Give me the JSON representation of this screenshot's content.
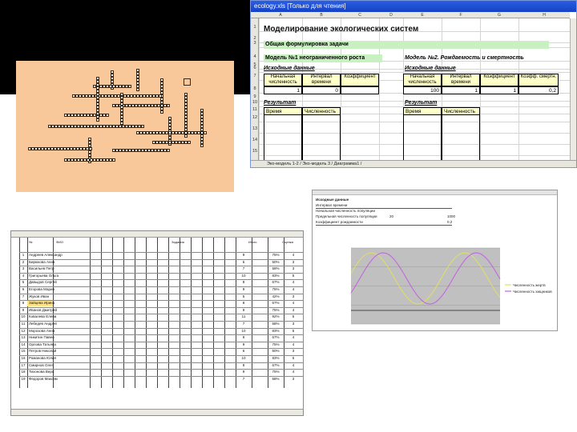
{
  "ecology": {
    "window_title": "ecology.xls [Только для чтения]",
    "columns": [
      "A",
      "B",
      "C",
      "D",
      "E",
      "F",
      "G",
      "H"
    ],
    "rows": [
      "1",
      "2",
      "3",
      "4",
      "5",
      "6",
      "7",
      "8",
      "9",
      "10",
      "11",
      "12",
      "13",
      "14",
      "15"
    ],
    "doc_title": "Моделирование экологических систем",
    "task_label": "Общая формулировка задачи",
    "model1_title": "Модель №1 неограниченного роста",
    "model2_title": "Модель №2. Рождаемость и смертность",
    "initial_data_left": "Исходные данные",
    "initial_data_right": "Исходные данные",
    "left_headers": [
      "Начальная численность",
      "Интервал времени",
      "Коэффициент"
    ],
    "right_headers": [
      "Начальная численность",
      "Интервал времени",
      "Коэффициент",
      "Коэфф. смертн."
    ],
    "left_values": [
      "1",
      "0",
      ""
    ],
    "right_values": [
      "100",
      "1",
      "1",
      "0,2"
    ],
    "result_left": "Результат",
    "result_right": "Результат",
    "result_headers_left": [
      "Время",
      "Численность"
    ],
    "result_headers_right": [
      "Время",
      "Численность"
    ],
    "sheet_tabs": "Эко-модель 1-2 / Эко-модель 3 / Диаграмма1 /"
  },
  "chart_window": {
    "lines": [
      "Исходные данные",
      "Интервал времени",
      "Начальная численность популяции",
      "Предельная численность популяции",
      "Коэффициент рождаемости"
    ],
    "values": [
      "20",
      "1000",
      "0,2"
    ],
    "legend": [
      "Численность жертв",
      "Численность хищников"
    ]
  },
  "grades": {
    "header_labels": [
      "№",
      "ФИО",
      "Задания",
      "Итого",
      "Оценка"
    ],
    "rows": [
      {
        "n": "1",
        "name": "Андреев Александр",
        "total": "9",
        "pct": "75%",
        "grade": "4"
      },
      {
        "n": "2",
        "name": "Бирюкова Анна",
        "total": "6",
        "pct": "50%",
        "grade": "3"
      },
      {
        "n": "3",
        "name": "Васильев Петр",
        "total": "7",
        "pct": "58%",
        "grade": "3"
      },
      {
        "n": "4",
        "name": "Григорьева Ольга",
        "total": "10",
        "pct": "83%",
        "grade": "5"
      },
      {
        "n": "5",
        "name": "Давыдов Сергей",
        "total": "8",
        "pct": "67%",
        "grade": "4"
      },
      {
        "n": "6",
        "name": "Егорова Мария",
        "total": "9",
        "pct": "75%",
        "grade": "4"
      },
      {
        "n": "7",
        "name": "Жуков Иван",
        "total": "5",
        "pct": "42%",
        "grade": "3"
      },
      {
        "n": "8",
        "name": "Зайцева Ирина",
        "total": "8",
        "pct": "67%",
        "grade": "4"
      },
      {
        "n": "9",
        "name": "Иванов Дмитрий",
        "total": "9",
        "pct": "75%",
        "grade": "4"
      },
      {
        "n": "10",
        "name": "Ковалева Елена",
        "total": "11",
        "pct": "92%",
        "grade": "5"
      },
      {
        "n": "11",
        "name": "Лебедев Андрей",
        "total": "7",
        "pct": "58%",
        "grade": "3"
      },
      {
        "n": "12",
        "name": "Морозова Анна",
        "total": "10",
        "pct": "83%",
        "grade": "5"
      },
      {
        "n": "13",
        "name": "Никитин Павел",
        "total": "8",
        "pct": "67%",
        "grade": "4"
      },
      {
        "n": "14",
        "name": "Орлова Татьяна",
        "total": "9",
        "pct": "75%",
        "grade": "4"
      },
      {
        "n": "15",
        "name": "Петров Николай",
        "total": "6",
        "pct": "50%",
        "grade": "3"
      },
      {
        "n": "16",
        "name": "Романова Юлия",
        "total": "10",
        "pct": "83%",
        "grade": "5"
      },
      {
        "n": "17",
        "name": "Смирнов Олег",
        "total": "8",
        "pct": "67%",
        "grade": "4"
      },
      {
        "n": "18",
        "name": "Тихонова Вера",
        "total": "9",
        "pct": "75%",
        "grade": "4"
      },
      {
        "n": "19",
        "name": "Федоров Максим",
        "total": "7",
        "pct": "58%",
        "grade": "3"
      }
    ]
  },
  "colors": {
    "crossword_bg": "#f8c89a",
    "green_band": "#c8f0c0",
    "yellow_cell": "#ffffc8",
    "chart_plot_bg": "#c0c0c0",
    "series_victims": "#e0e060",
    "series_predators": "#c060e0",
    "title_bar": "#2b5ee0"
  }
}
